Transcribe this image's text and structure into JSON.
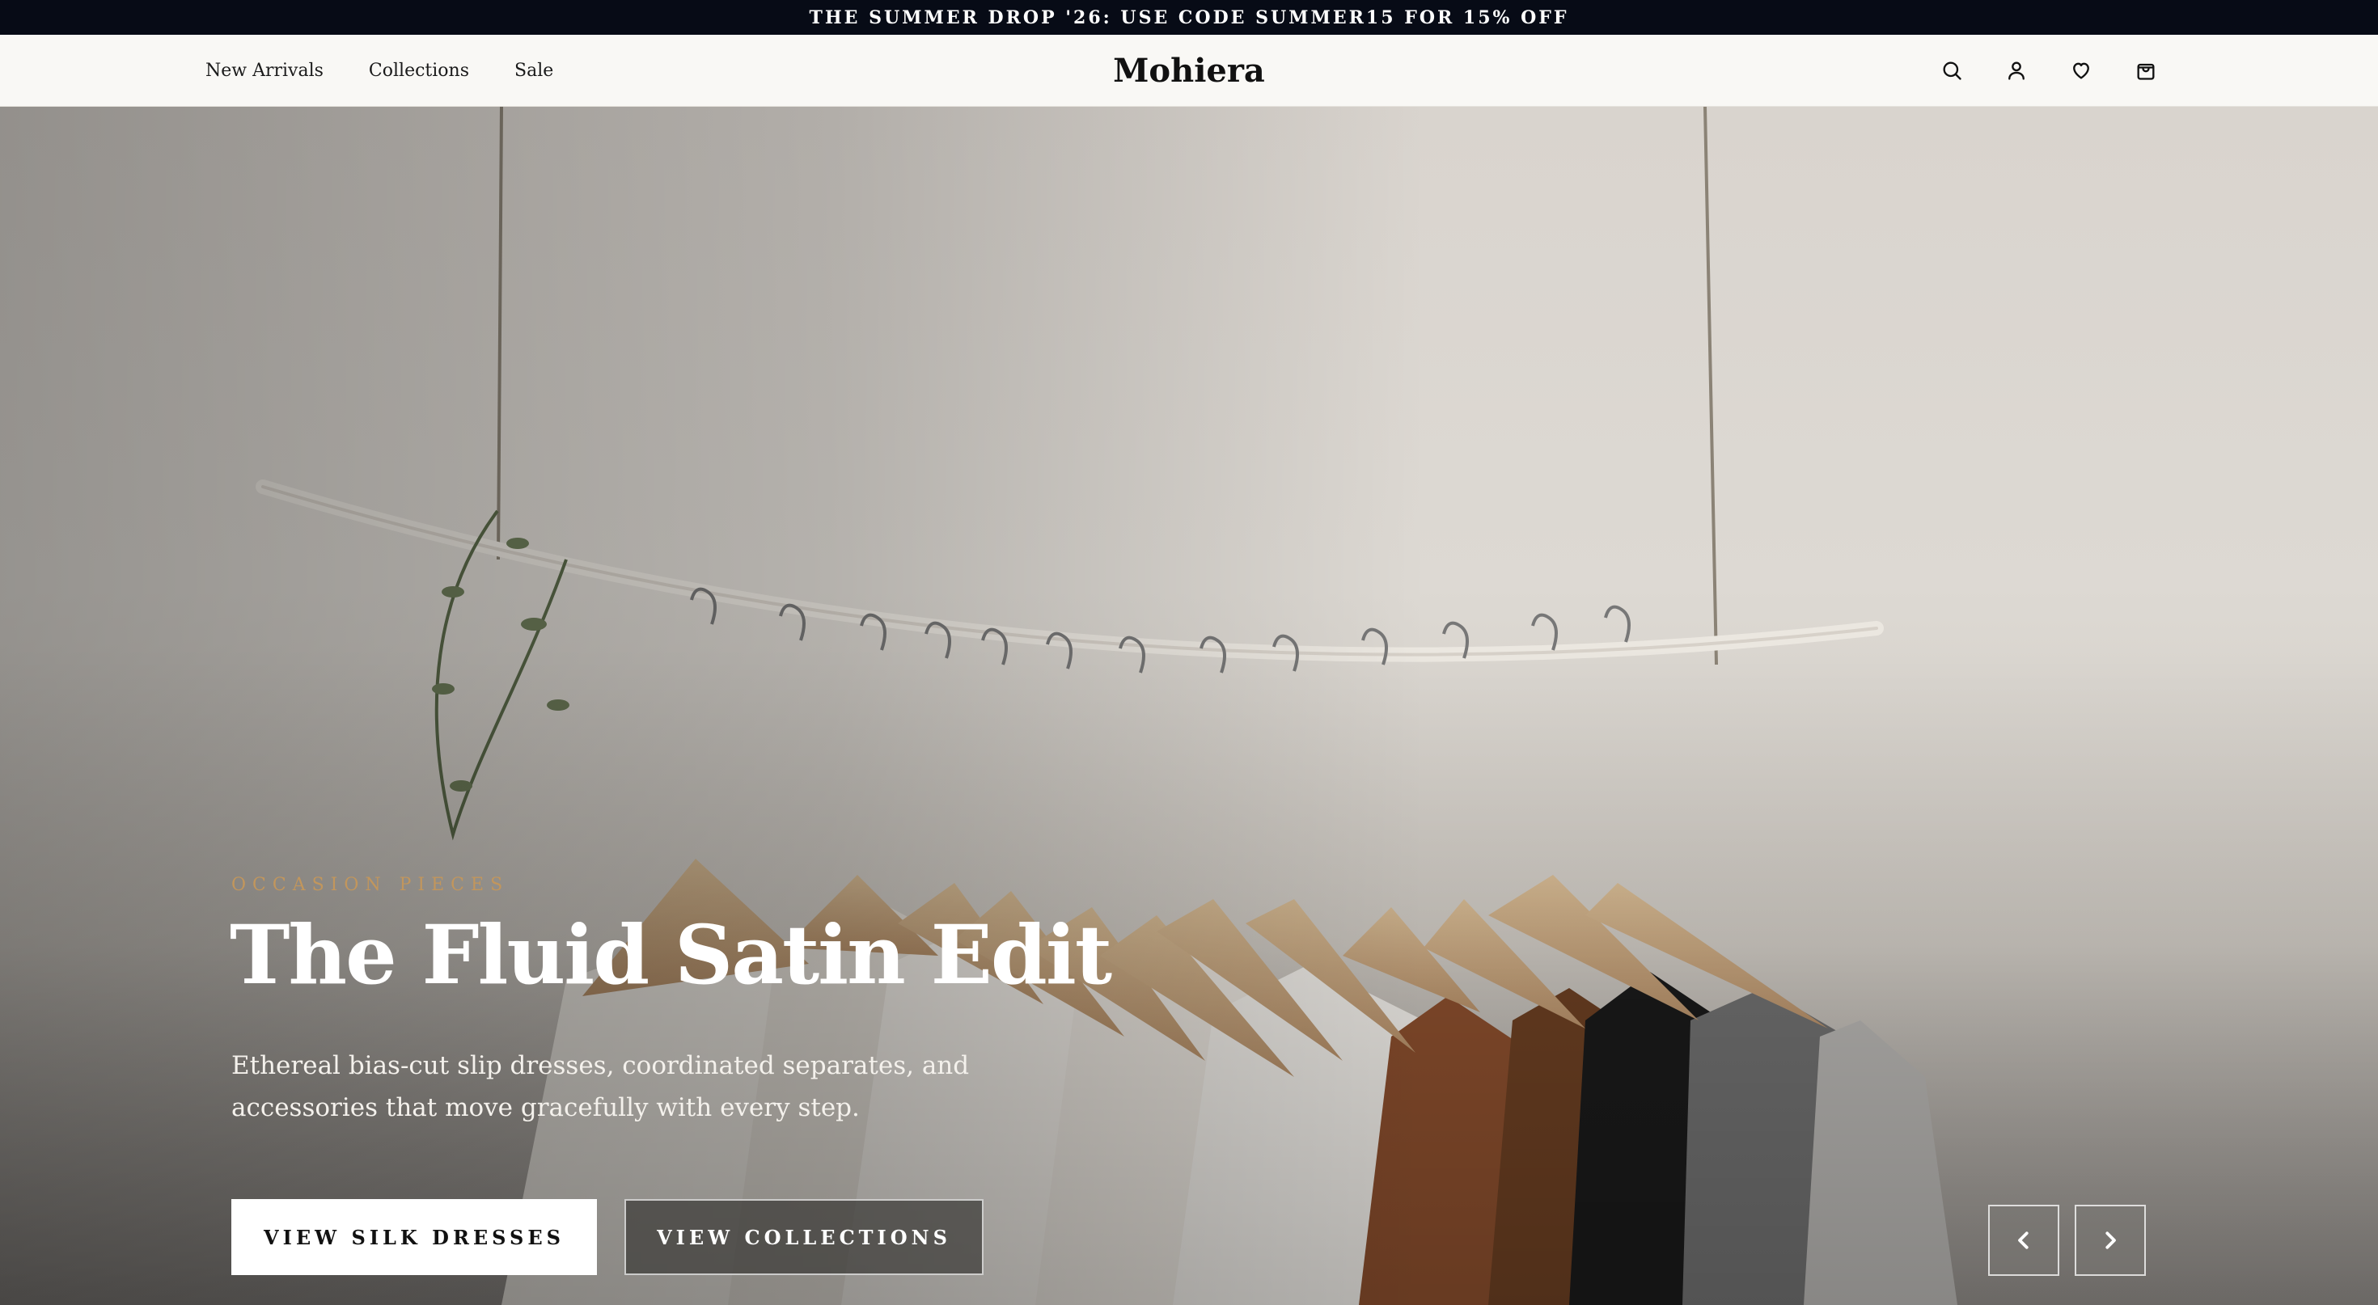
{
  "announcement": {
    "text": "THE SUMMER DROP '26: USE CODE SUMMER15 FOR 15% OFF"
  },
  "header": {
    "logo": "Mohiera",
    "nav": [
      "New Arrivals",
      "Collections",
      "Sale"
    ],
    "icons": [
      "search-icon",
      "account-icon",
      "wishlist-icon",
      "cart-icon"
    ]
  },
  "hero": {
    "eyebrow": "OCCASION PIECES",
    "title": "The Fluid Satin Edit",
    "subtitle": "Ethereal bias-cut slip dresses, coordinated separates, and accessories that move gracefully with every step.",
    "primary_cta": "VIEW SILK DRESSES",
    "secondary_cta": "VIEW COLLECTIONS",
    "controls": [
      "chevron-left-icon",
      "chevron-right-icon"
    ]
  },
  "colors": {
    "announcement_bg": "#070b16",
    "header_bg": "#f9f8f5",
    "eyebrow": "#c2965c"
  }
}
